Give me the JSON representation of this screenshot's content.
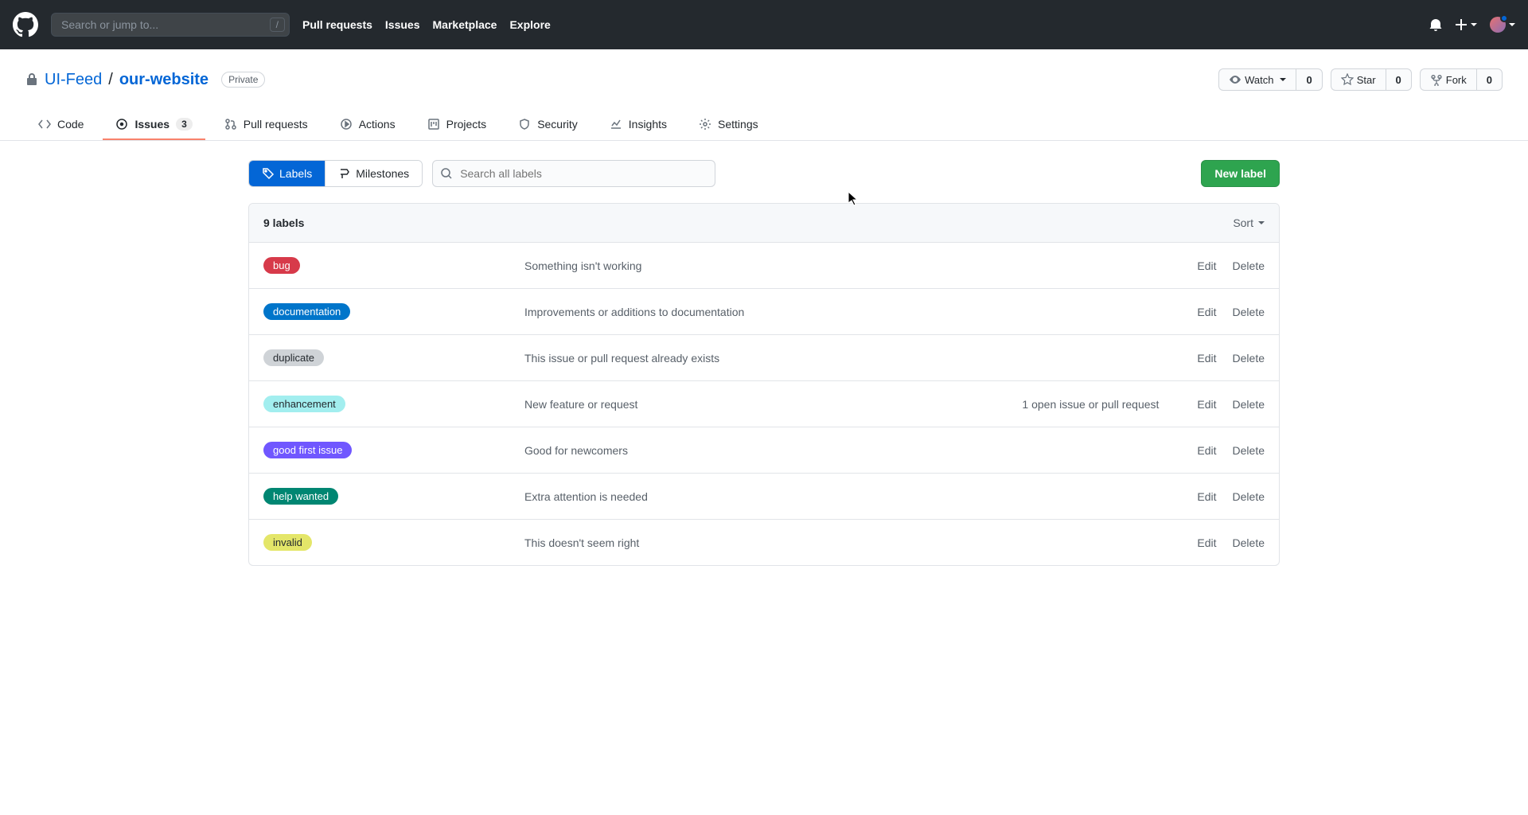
{
  "header": {
    "search_placeholder": "Search or jump to...",
    "slash_hint": "/",
    "nav": [
      "Pull requests",
      "Issues",
      "Marketplace",
      "Explore"
    ]
  },
  "repo": {
    "owner": "UI-Feed",
    "name": "our-website",
    "privacy": "Private",
    "watch_label": "Watch",
    "watch_count": "0",
    "star_label": "Star",
    "star_count": "0",
    "fork_label": "Fork",
    "fork_count": "0"
  },
  "tabs": {
    "code": "Code",
    "issues": "Issues",
    "issues_count": "3",
    "pulls": "Pull requests",
    "actions": "Actions",
    "projects": "Projects",
    "security": "Security",
    "insights": "Insights",
    "settings": "Settings"
  },
  "subnav": {
    "labels_btn": "Labels",
    "milestones_btn": "Milestones",
    "search_placeholder": "Search all labels",
    "new_label_btn": "New label"
  },
  "list": {
    "count_text": "9 labels",
    "sort": "Sort",
    "edit": "Edit",
    "delete": "Delete",
    "items": [
      {
        "name": "bug",
        "bg": "#d73a4a",
        "fg": "#fff",
        "desc": "Something isn't working",
        "meta": ""
      },
      {
        "name": "documentation",
        "bg": "#0075ca",
        "fg": "#fff",
        "desc": "Improvements or additions to documentation",
        "meta": ""
      },
      {
        "name": "duplicate",
        "bg": "#cfd3d7",
        "fg": "#24292e",
        "desc": "This issue or pull request already exists",
        "meta": ""
      },
      {
        "name": "enhancement",
        "bg": "#a2eeef",
        "fg": "#24292e",
        "desc": "New feature or request",
        "meta": "1 open issue or pull request"
      },
      {
        "name": "good first issue",
        "bg": "#7057ff",
        "fg": "#fff",
        "desc": "Good for newcomers",
        "meta": ""
      },
      {
        "name": "help wanted",
        "bg": "#008672",
        "fg": "#fff",
        "desc": "Extra attention is needed",
        "meta": ""
      },
      {
        "name": "invalid",
        "bg": "#e4e669",
        "fg": "#24292e",
        "desc": "This doesn't seem right",
        "meta": ""
      }
    ]
  }
}
